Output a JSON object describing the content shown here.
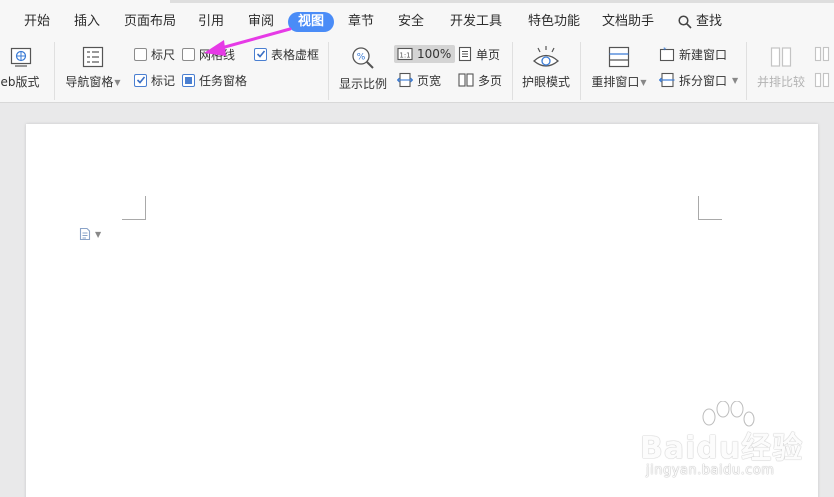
{
  "tabs": [
    {
      "label": "开始"
    },
    {
      "label": "插入"
    },
    {
      "label": "页面布局"
    },
    {
      "label": "引用"
    },
    {
      "label": "审阅"
    },
    {
      "label": "视图"
    },
    {
      "label": "章节"
    },
    {
      "label": "安全"
    },
    {
      "label": "开发工具"
    },
    {
      "label": "特色功能"
    },
    {
      "label": "文档助手"
    },
    {
      "label": "查找"
    }
  ],
  "active_tab": "视图",
  "ribbon": {
    "web_layout": "eb版式",
    "nav_pane": "导航窗格",
    "ruler": "标尺",
    "gridlines": "网格线",
    "table_gridlines": "表格虚框",
    "marks": "标记",
    "task_pane": "任务窗格",
    "zoom": "显示比例",
    "zoom_100": "100%",
    "page_width": "页宽",
    "single_page": "单页",
    "multi_page": "多页",
    "eye_mode": "护眼模式",
    "arrange": "重排窗口",
    "new_window": "新建窗口",
    "split_window": "拆分窗口",
    "side_by_side": "并排比较"
  },
  "checkbox_states": {
    "ruler": false,
    "gridlines": false,
    "table_gridlines": true,
    "marks": true,
    "task_pane": true
  },
  "watermark": {
    "main": "Baidu经验",
    "sub": "jingyan.baidu.com"
  },
  "colors": {
    "accent": "#4a8cf7",
    "arrow": "#e63ae6",
    "ribbon_bg": "#f7f7f7",
    "doc_bg": "#e9e9ea"
  }
}
